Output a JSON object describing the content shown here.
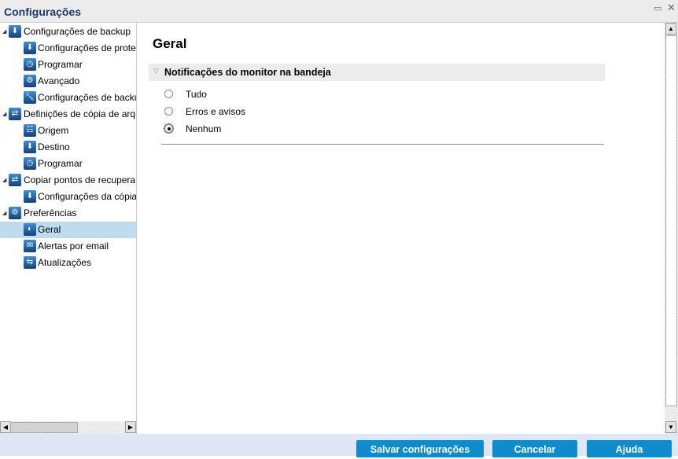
{
  "window": {
    "title": "Configurações",
    "restore_icon": "restore-icon",
    "close_icon": "close-icon"
  },
  "tree": [
    {
      "label": "Configurações de backup",
      "level": 0,
      "icon": "download-disk-icon"
    },
    {
      "label": "Configurações de prote",
      "level": 1,
      "icon": "protection-icon"
    },
    {
      "label": "Programar",
      "level": 1,
      "icon": "clock-icon"
    },
    {
      "label": "Avançado",
      "level": 1,
      "icon": "gears-icon"
    },
    {
      "label": "Configurações de backu",
      "level": 1,
      "icon": "wrench-icon"
    },
    {
      "label": "Definições de cópia de arq",
      "level": 0,
      "icon": "file-copy-icon"
    },
    {
      "label": "Origem",
      "level": 1,
      "icon": "network-icon"
    },
    {
      "label": "Destino",
      "level": 1,
      "icon": "destination-icon"
    },
    {
      "label": "Programar",
      "level": 1,
      "icon": "clock-icon"
    },
    {
      "label": "Copiar pontos de recupera",
      "level": 0,
      "icon": "copy-recovery-icon"
    },
    {
      "label": "Configurações da cópia",
      "level": 1,
      "icon": "protection-icon"
    },
    {
      "label": "Preferências",
      "level": 0,
      "icon": "gear-icon"
    },
    {
      "label": "Geral",
      "level": 1,
      "icon": "globe-icon",
      "selected": true
    },
    {
      "label": "Alertas por email",
      "level": 1,
      "icon": "email-icon"
    },
    {
      "label": "Atualizações",
      "level": 1,
      "icon": "updates-icon"
    }
  ],
  "main": {
    "title": "Geral",
    "section": "Notificações do monitor na bandeja",
    "options": [
      {
        "label": "Tudo",
        "checked": false
      },
      {
        "label": "Erros e avisos",
        "checked": false
      },
      {
        "label": "Nenhum",
        "checked": true
      }
    ]
  },
  "footer": {
    "save": "Salvar configurações",
    "cancel": "Cancelar",
    "help": "Ajuda"
  }
}
